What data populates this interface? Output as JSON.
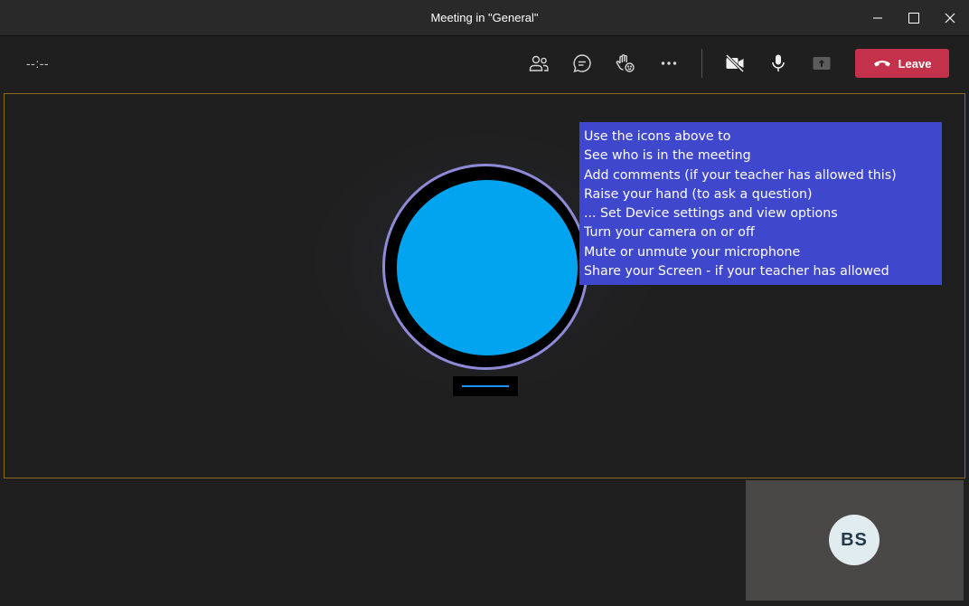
{
  "window": {
    "title": "Meeting in \"General\""
  },
  "toolbar": {
    "timer": "--:--",
    "buttons": [
      "participants-icon",
      "chat-icon",
      "raise-hand-icon",
      "more-options-icon",
      "camera-off-icon",
      "microphone-icon",
      "share-screen-icon"
    ],
    "leave_label": "Leave",
    "leave_color": "#c4314b"
  },
  "help_overlay": {
    "lines": [
      "Use the icons above to",
      "See who is in the meeting",
      "Add comments (if your teacher has allowed this)",
      "Raise your hand (to ask a question)",
      "... Set Device settings and view options",
      "Turn your camera on or off",
      "Mute or unmute your microphone",
      "Share your Screen - if your teacher has allowed"
    ],
    "background": "#3f48cc"
  },
  "self_view": {
    "initials": "BS"
  },
  "colors": {
    "avatar_fill": "#00a4ef",
    "avatar_ring": "#8f8ad8",
    "stage_border": "#8a6a1e"
  }
}
